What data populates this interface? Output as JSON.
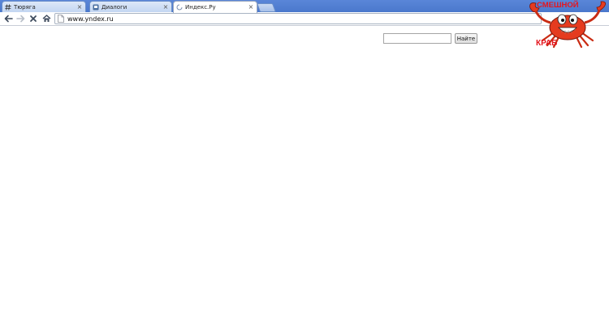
{
  "browser": {
    "tabs": [
      {
        "title": "Тюряга",
        "icon": "hash-icon",
        "active": false,
        "close": "×"
      },
      {
        "title": "Диалоги",
        "icon": "vk-chat-icon",
        "active": false,
        "close": "×"
      },
      {
        "title": "Индекс.Ру",
        "icon": "loading-icon",
        "active": true,
        "close": "×"
      }
    ],
    "address_bar": {
      "url": "www.yndex.ru"
    }
  },
  "page": {
    "search": {
      "value": "",
      "button_label": "Найте"
    }
  },
  "watermark": {
    "top_text": "СМЕШНОЙ",
    "bottom_text": "КРАБ",
    "text_color": "#e5161e",
    "crab_color": "#e53b1f"
  },
  "colors": {
    "tabstrip": "#4a78cc",
    "tab_inactive": "#c3d6f2",
    "tab_active": "#ffffff"
  }
}
